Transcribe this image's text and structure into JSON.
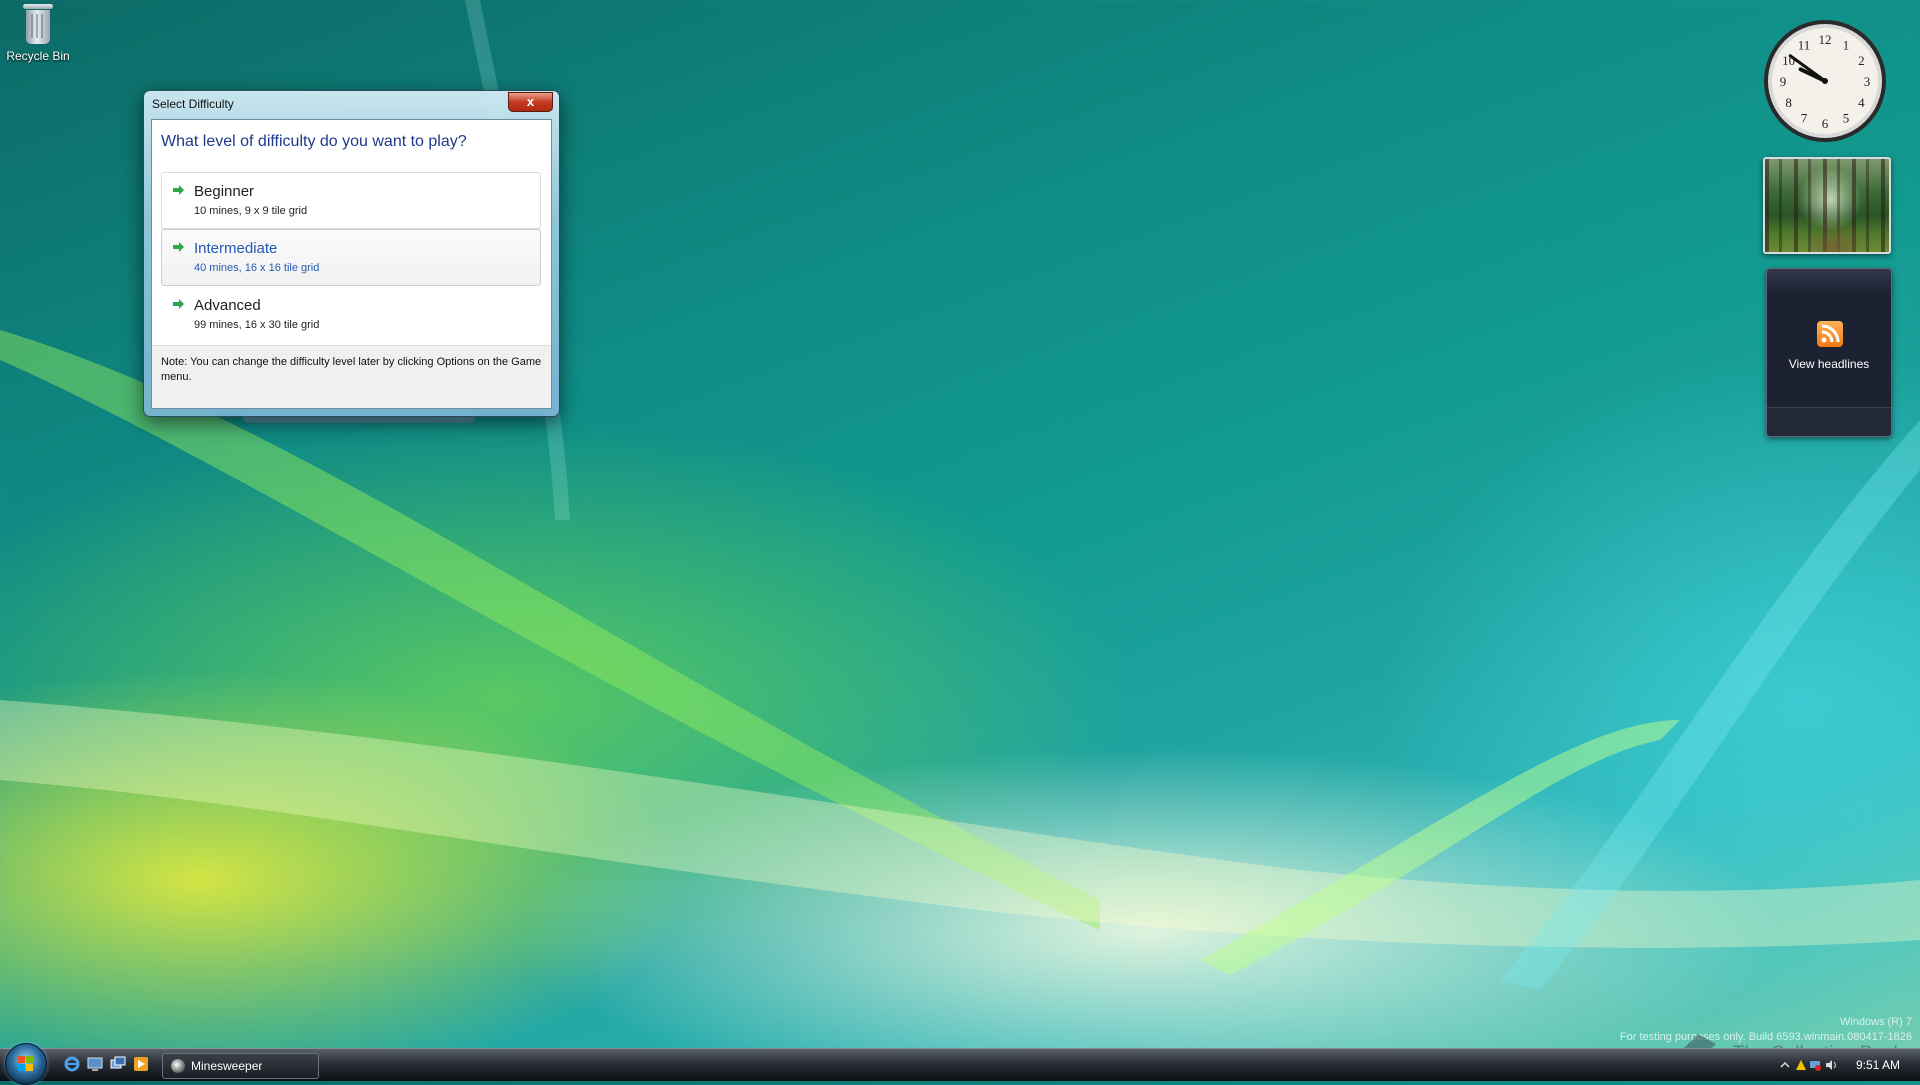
{
  "desktop": {
    "recycle_bin_label": "Recycle Bin"
  },
  "dialog": {
    "title": "Select Difficulty",
    "close_glyph": "x",
    "question": "What level of difficulty do you want to play?",
    "options": [
      {
        "name": "Beginner",
        "description": "10 mines, 9 x 9 tile grid",
        "icon": "green-arrow-icon"
      },
      {
        "name": "Intermediate",
        "description": "40 mines, 16 x 16 tile grid",
        "icon": "green-arrow-icon"
      },
      {
        "name": "Advanced",
        "description": "99 mines, 16 x 30 tile grid",
        "icon": "green-arrow-icon"
      }
    ],
    "hovered_option": "Intermediate",
    "note": "Note: You can change the difficulty level later by clicking Options on the Game menu."
  },
  "gadgets": {
    "clock": {
      "hour": 9,
      "minute": 51
    },
    "feed_label": "View headlines"
  },
  "watermark": {
    "line1": "Windows (R) 7",
    "line2": "For testing purposes only. Build 6593.winmain.080417-1826",
    "collection_book": "The Collection Book"
  },
  "taskbar": {
    "task_label": "Minesweeper",
    "time": "9:51 AM"
  },
  "colors": {
    "accent_blue": "#1d3a8a",
    "hover_blue": "#2459b3",
    "arrow_green": "#2aa84a"
  }
}
